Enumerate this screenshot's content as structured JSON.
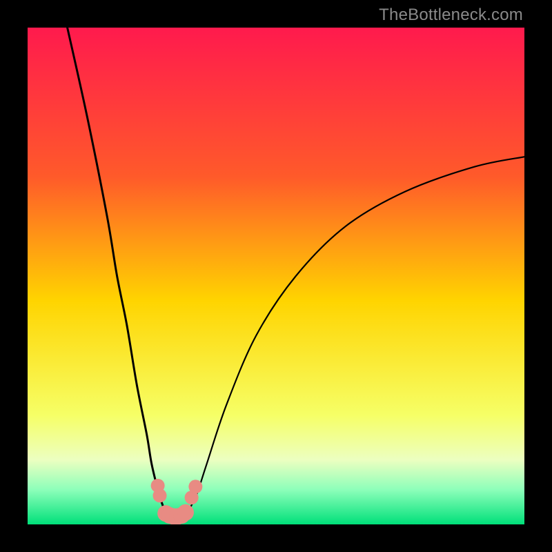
{
  "watermark": "TheBottleneck.com",
  "chart_data": {
    "type": "line",
    "title": "",
    "xlabel": "",
    "ylabel": "",
    "xlim": [
      0,
      100
    ],
    "ylim": [
      0,
      100
    ],
    "background_gradient": {
      "stops": [
        {
          "pct": 0,
          "color": "#ff1a4d"
        },
        {
          "pct": 30,
          "color": "#ff5a2a"
        },
        {
          "pct": 55,
          "color": "#ffd400"
        },
        {
          "pct": 78,
          "color": "#f6ff66"
        },
        {
          "pct": 87,
          "color": "#ecffc0"
        },
        {
          "pct": 93,
          "color": "#8dffba"
        },
        {
          "pct": 100,
          "color": "#00e07a"
        }
      ]
    },
    "series": [
      {
        "name": "left-branch",
        "color": "#000000",
        "width": 3,
        "x": [
          8,
          12,
          16,
          18,
          20,
          22,
          24,
          25,
          26.5,
          27.5,
          28
        ],
        "y": [
          100,
          82,
          62,
          50,
          40,
          28,
          18,
          12,
          6,
          3,
          2
        ]
      },
      {
        "name": "right-branch",
        "color": "#000000",
        "width": 2.2,
        "x": [
          32,
          34,
          36,
          40,
          46,
          54,
          64,
          76,
          90,
          100
        ],
        "y": [
          2,
          6,
          12,
          24,
          38,
          50,
          60,
          67,
          72,
          74
        ]
      },
      {
        "name": "left-dots",
        "type": "scatter",
        "color": "#e88b83",
        "radius": 10,
        "x": [
          26.2,
          26.6
        ],
        "y": [
          7.8,
          5.8
        ]
      },
      {
        "name": "right-dots",
        "type": "scatter",
        "color": "#e88b83",
        "radius": 10,
        "x": [
          33.0,
          33.8
        ],
        "y": [
          5.4,
          7.6
        ]
      },
      {
        "name": "bottom-snake",
        "type": "scatter",
        "color": "#e88b83",
        "radius": 12,
        "x": [
          27.8,
          28.6,
          29.4,
          30.2,
          31.0,
          31.8
        ],
        "y": [
          2.2,
          1.8,
          1.6,
          1.6,
          1.8,
          2.4
        ]
      }
    ]
  }
}
